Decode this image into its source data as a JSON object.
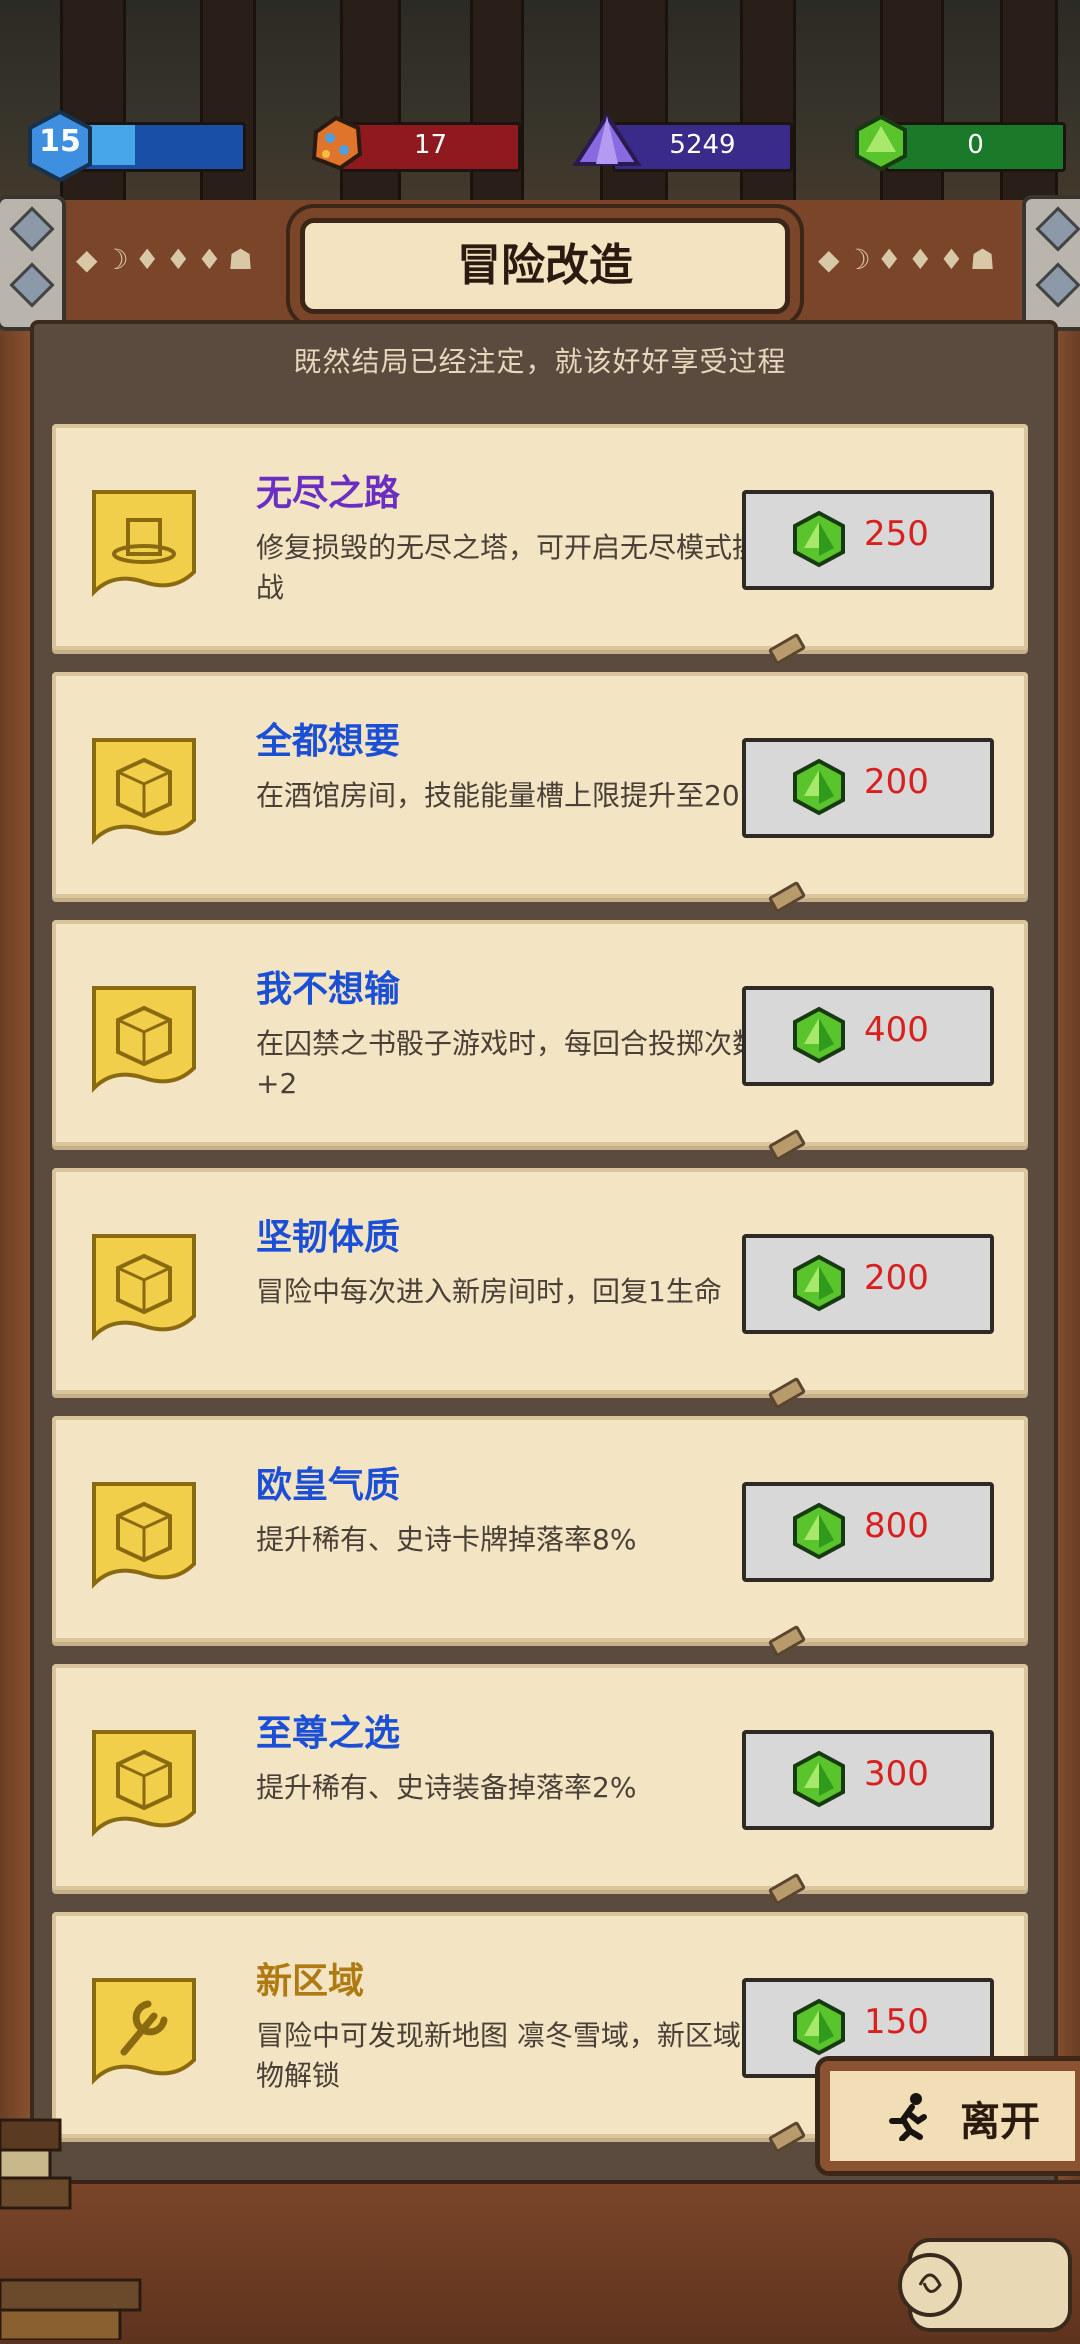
{
  "currency": {
    "level": "15",
    "ore": "17",
    "crystal": "5249",
    "gem": "0"
  },
  "header": {
    "title": "冒险改造",
    "subtitle": "既然结局已经注定，就该好好享受过程"
  },
  "upgrades": [
    {
      "title": "无尽之路",
      "desc": "修复损毁的无尽之塔，可开启无尽模式挑战",
      "price": "250",
      "title_color": "#6a2fc2",
      "icon": "hat-icon"
    },
    {
      "title": "全都想要",
      "desc": "在酒馆房间，技能能量槽上限提升至20",
      "price": "200",
      "title_color": "#1b4fd6",
      "icon": "dice-icon"
    },
    {
      "title": "我不想输",
      "desc": "在囚禁之书骰子游戏时，每回合投掷次数+2",
      "price": "400",
      "title_color": "#1b4fd6",
      "icon": "dice-icon"
    },
    {
      "title": "坚韧体质",
      "desc": "冒险中每次进入新房间时，回复1生命",
      "price": "200",
      "title_color": "#1b4fd6",
      "icon": "dice-icon"
    },
    {
      "title": "欧皇气质",
      "desc": "提升稀有、史诗卡牌掉落率8%",
      "price": "800",
      "title_color": "#1b4fd6",
      "icon": "dice-icon"
    },
    {
      "title": "至尊之选",
      "desc": "提升稀有、史诗装备掉落率2%",
      "price": "300",
      "title_color": "#1b4fd6",
      "icon": "dice-icon"
    },
    {
      "title": "新区域",
      "desc": "冒险中可发现新地图 凛冬雪域，新区域怪物解锁",
      "price": "150",
      "title_color": "#b07a12",
      "icon": "wrench-icon"
    }
  ],
  "leave_button": {
    "label": "离开"
  },
  "colors": {
    "level_bar": "#1a4fa8",
    "ore_bar": "#8e1a1f",
    "crystal_bar": "#3a2a8a",
    "gem_bar": "#1a7a2a",
    "price": "#d8201e"
  }
}
